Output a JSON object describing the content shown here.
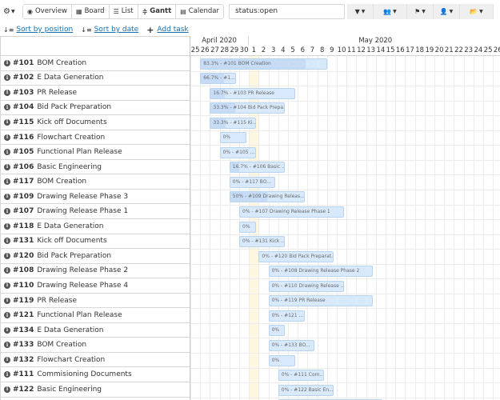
{
  "toolbar": {
    "views": [
      {
        "label": "Overview",
        "icon": "eye-icon",
        "glyph": "◉",
        "active": false
      },
      {
        "label": "Board",
        "icon": "board-icon",
        "glyph": "▦",
        "active": false
      },
      {
        "label": "List",
        "icon": "list-icon",
        "glyph": "☰",
        "active": false
      },
      {
        "label": "Gantt",
        "icon": "gantt-icon",
        "glyph": "≑",
        "active": true
      },
      {
        "label": "Calendar",
        "icon": "calendar-icon",
        "glyph": "▤",
        "active": false
      }
    ],
    "status_value": "status:open",
    "filters": [
      {
        "icon": "filter-icon",
        "glyph": "▼"
      },
      {
        "icon": "users-icon",
        "glyph": "👥"
      },
      {
        "icon": "flag-icon",
        "glyph": "⚑"
      },
      {
        "icon": "user-icon",
        "glyph": "👤"
      },
      {
        "icon": "folder-icon",
        "glyph": "📂"
      }
    ]
  },
  "subbar": {
    "sort_position": "Sort by position",
    "sort_date": "Sort by date",
    "add_task": "Add task"
  },
  "timeline": {
    "months": [
      "April 2020",
      "May 2020"
    ],
    "days": [
      "25",
      "26",
      "27",
      "28",
      "29",
      "30",
      "1",
      "2",
      "3",
      "4",
      "5",
      "6",
      "7",
      "8",
      "9",
      "10",
      "11",
      "12",
      "13",
      "14",
      "15",
      "16",
      "17",
      "18",
      "19",
      "20",
      "21",
      "22",
      "23",
      "24",
      "25",
      "26"
    ]
  },
  "tasks": [
    {
      "num": "#101",
      "name": "BOM Creation",
      "label": "83.3% - #101 BOM Creation",
      "start": 1,
      "end": 14,
      "progress": 0.833
    },
    {
      "num": "#102",
      "name": "E Data Generation",
      "label": "66.7% - #1...",
      "start": 1,
      "end": 4.7,
      "progress": 0.667
    },
    {
      "num": "#103",
      "name": "PR Release",
      "label": "16.7% - #103 PR Release",
      "start": 2,
      "end": 10.7,
      "progress": 0.167
    },
    {
      "num": "#104",
      "name": "Bid Pack Preparation",
      "label": "33.3% - #104 Bid Pack Prepa...",
      "start": 2,
      "end": 9.7,
      "progress": 0.333
    },
    {
      "num": "#115",
      "name": "Kick off Documents",
      "label": "33.3% - #115 Ki...",
      "start": 2,
      "end": 6.7,
      "progress": 0.333
    },
    {
      "num": "#116",
      "name": "Flowchart Creation",
      "label": "0%",
      "start": 3,
      "end": 5.7,
      "progress": 0
    },
    {
      "num": "#105",
      "name": "Functional Plan Release",
      "label": "0% - #105 ...",
      "start": 3,
      "end": 6.7,
      "progress": 0
    },
    {
      "num": "#106",
      "name": "Basic Engineering",
      "label": "16.7% - #106 Basic ...",
      "start": 4,
      "end": 9.7,
      "progress": 0.167
    },
    {
      "num": "#117",
      "name": "BOM Creation",
      "label": "0% - #117 BO...",
      "start": 4,
      "end": 8.7,
      "progress": 0
    },
    {
      "num": "#109",
      "name": "Drawing Release Phase 3",
      "label": "50% - #109 Drawing Releas...",
      "start": 4,
      "end": 11.7,
      "progress": 0.5
    },
    {
      "num": "#107",
      "name": "Drawing Release Phase 1",
      "label": "0% - #107 Drawing Release Phase 1",
      "start": 5,
      "end": 15.7,
      "progress": 0
    },
    {
      "num": "#118",
      "name": "E Data Generation",
      "label": "0%",
      "start": 5,
      "end": 6.7,
      "progress": 0
    },
    {
      "num": "#131",
      "name": "Kick off Documents",
      "label": "0% - #131 Kick ...",
      "start": 5,
      "end": 9.7,
      "progress": 0
    },
    {
      "num": "#120",
      "name": "Bid Pack Preparation",
      "label": "0% - #120 Bid Pack Preparat...",
      "start": 7,
      "end": 14.7,
      "progress": 0
    },
    {
      "num": "#108",
      "name": "Drawing Release Phase 2",
      "label": "0% - #108 Drawing Release Phase 2",
      "start": 8,
      "end": 18.7,
      "progress": 0
    },
    {
      "num": "#110",
      "name": "Drawing Release Phase 4",
      "label": "0% - #110 Drawing Release ...",
      "start": 8,
      "end": 15.7,
      "progress": 0
    },
    {
      "num": "#119",
      "name": "PR Release",
      "label": "0% - #119 PR Release",
      "start": 8,
      "end": 18.7,
      "progress": 0
    },
    {
      "num": "#121",
      "name": "Functional Plan Release",
      "label": "0% - #121 ...",
      "start": 8,
      "end": 11.7,
      "progress": 0
    },
    {
      "num": "#134",
      "name": "E Data Generation",
      "label": "0%",
      "start": 8,
      "end": 9.7,
      "progress": 0
    },
    {
      "num": "#133",
      "name": "BOM Creation",
      "label": "0% - #133 BO...",
      "start": 8,
      "end": 12.7,
      "progress": 0
    },
    {
      "num": "#132",
      "name": "Flowchart Creation",
      "label": "0%",
      "start": 8,
      "end": 10.7,
      "progress": 0
    },
    {
      "num": "#111",
      "name": "Commisioning Documents",
      "label": "0% - #111 Com...",
      "start": 9,
      "end": 13.7,
      "progress": 0
    },
    {
      "num": "#122",
      "name": "Basic Engineering",
      "label": "0% - #122 Basic En...",
      "start": 9,
      "end": 14.7,
      "progress": 0
    },
    {
      "num": "",
      "name": "",
      "label": "",
      "start": 9,
      "end": 19.7,
      "progress": 0
    }
  ]
}
